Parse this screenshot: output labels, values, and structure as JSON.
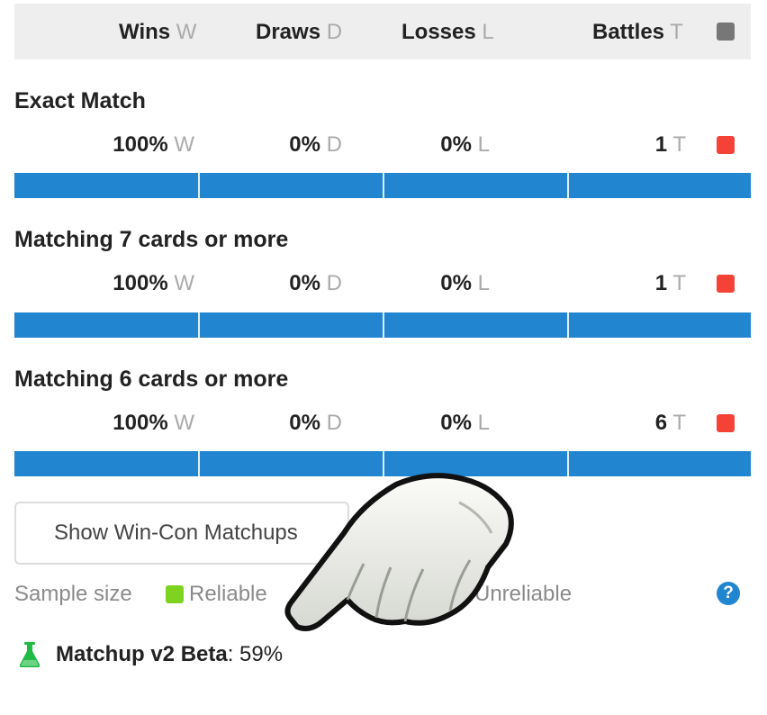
{
  "header": {
    "wins_label": "Wins",
    "wins_suffix": "W",
    "draws_label": "Draws",
    "draws_suffix": "D",
    "losses_label": "Losses",
    "losses_suffix": "L",
    "battles_label": "Battles",
    "battles_suffix": "T",
    "square_color": "#777777"
  },
  "sections": [
    {
      "title": "Exact Match",
      "wins": "100%",
      "draws": "0%",
      "losses": "0%",
      "battles": "1",
      "indicator_color": "#f44336",
      "win_fraction": 1.0
    },
    {
      "title": "Matching 7 cards or more",
      "wins": "100%",
      "draws": "0%",
      "losses": "0%",
      "battles": "1",
      "indicator_color": "#f44336",
      "win_fraction": 1.0
    },
    {
      "title": "Matching 6 cards or more",
      "wins": "100%",
      "draws": "0%",
      "losses": "0%",
      "battles": "6",
      "indicator_color": "#f44336",
      "win_fraction": 1.0
    }
  ],
  "suffixes": {
    "w": "W",
    "d": "D",
    "l": "L",
    "t": "T"
  },
  "button": {
    "label": "Show Win-Con Matchups"
  },
  "legend": {
    "title": "Sample size",
    "reliable_label": "Reliable",
    "reliable_color": "#7ed321",
    "unreliable_label": "Unreliable",
    "unreliable_color": "#f44336",
    "help_icon": "question-circle-icon"
  },
  "beta": {
    "icon": "flask-icon",
    "label": "Matchup v2 Beta",
    "value": ": 59%",
    "icon_color": "#21ba45"
  },
  "colors": {
    "bar": "#2185d0",
    "header_bg": "#eeeeee"
  }
}
